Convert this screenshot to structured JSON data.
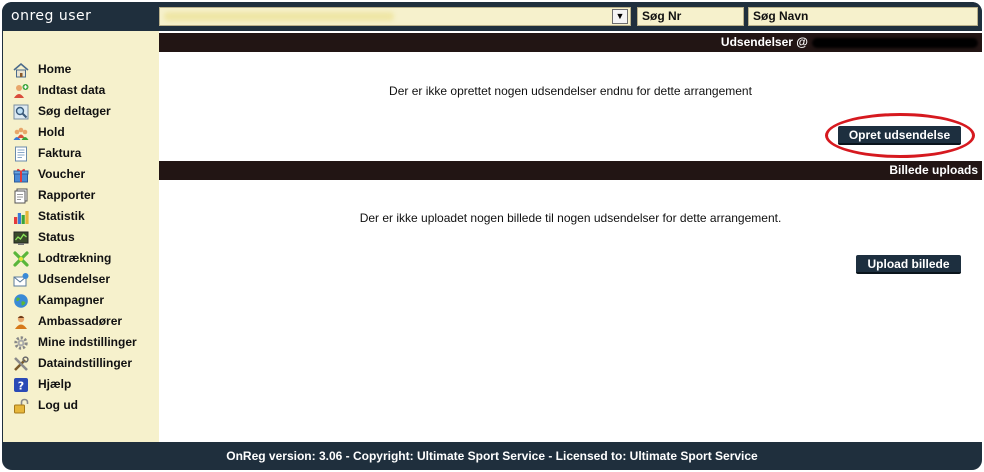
{
  "header": {
    "app_title": "onreg user",
    "search_nr": "Søg Nr",
    "search_navn": "Søg Navn"
  },
  "sidebar": {
    "items": [
      {
        "label": "Home",
        "icon": "home-icon"
      },
      {
        "label": "Indtast data",
        "icon": "add-user-icon"
      },
      {
        "label": "Søg deltager",
        "icon": "search-icon"
      },
      {
        "label": "Hold",
        "icon": "team-icon"
      },
      {
        "label": "Faktura",
        "icon": "invoice-icon"
      },
      {
        "label": "Voucher",
        "icon": "gift-icon"
      },
      {
        "label": "Rapporter",
        "icon": "report-icon"
      },
      {
        "label": "Statistik",
        "icon": "bar-chart-icon"
      },
      {
        "label": "Status",
        "icon": "status-icon"
      },
      {
        "label": "Lodtrækning",
        "icon": "lottery-icon"
      },
      {
        "label": "Udsendelser",
        "icon": "mail-icon"
      },
      {
        "label": "Kampagner",
        "icon": "globe-icon"
      },
      {
        "label": "Ambassadører",
        "icon": "ambassador-icon"
      },
      {
        "label": "Mine indstillinger",
        "icon": "gear-icon"
      },
      {
        "label": "Dataindstillinger",
        "icon": "tools-icon"
      },
      {
        "label": "Hjælp",
        "icon": "help-icon"
      },
      {
        "label": "Log ud",
        "icon": "lock-icon"
      }
    ]
  },
  "udsendelser": {
    "title": "Udsendelser @",
    "empty_message": "Der er ikke oprettet nogen udsendelser endnu for dette arrangement",
    "create_button": "Opret udsendelse"
  },
  "billede": {
    "title": "Billede uploads",
    "empty_message": "Der er ikke uploadet nogen billede til nogen udsendelser for dette arrangement.",
    "upload_button": "Upload billede"
  },
  "footer": {
    "text": "OnReg version: 3.06 - Copyright: Ultimate Sport Service - Licensed to: Ultimate Sport Service"
  },
  "colors": {
    "frame": "#1f2f3d",
    "sidebar_bg": "#f6f1cc",
    "section_bar": "#221514",
    "button": "#1d2f3f",
    "highlight": "#d6191f"
  }
}
